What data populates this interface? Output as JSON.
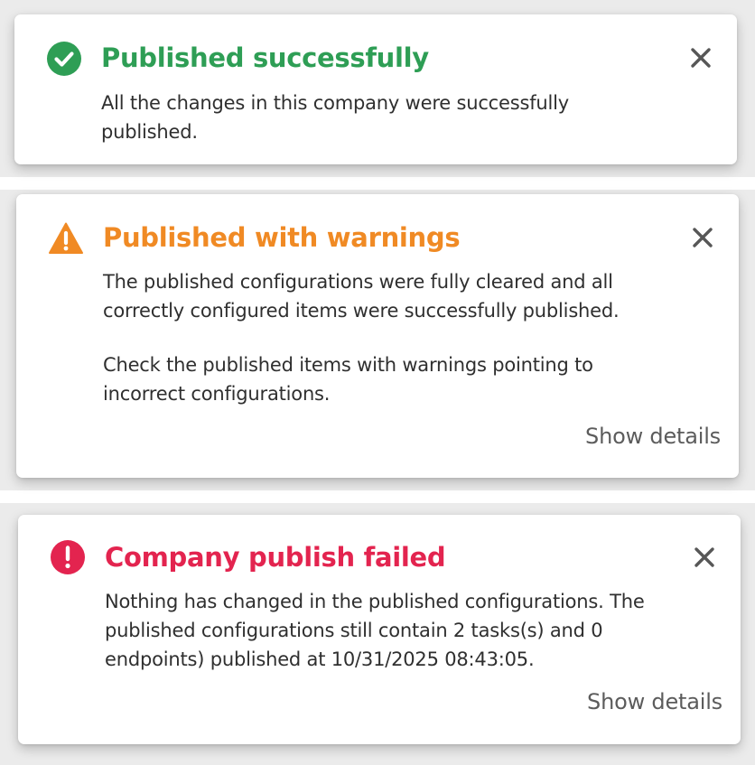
{
  "colors": {
    "success": "#2e9e55",
    "warning": "#f08a24",
    "error": "#e3244f",
    "close": "#575757",
    "body_text": "#2f2f2f",
    "link_text": "#5c5c5c"
  },
  "toasts": [
    {
      "kind": "success",
      "icon": "check-circle-icon",
      "title": "Published successfully",
      "body": [
        "All the changes in this company were successfully published."
      ],
      "close_icon": "close-icon"
    },
    {
      "kind": "warning",
      "icon": "warning-triangle-icon",
      "title": "Published with warnings",
      "body": [
        "The published configurations were fully cleared and all correctly configured items were successfully published.",
        "Check the published items with warnings pointing to incorrect configurations."
      ],
      "details_label": "Show details",
      "close_icon": "close-icon"
    },
    {
      "kind": "error",
      "icon": "exclamation-circle-icon",
      "title": "Company publish failed",
      "body": [
        "Nothing has changed in the published configurations. The published configurations still contain 2 tasks(s) and 0 endpoints) published at 10/31/2025 08:43:05."
      ],
      "details_label": "Show details",
      "close_icon": "close-icon"
    }
  ]
}
